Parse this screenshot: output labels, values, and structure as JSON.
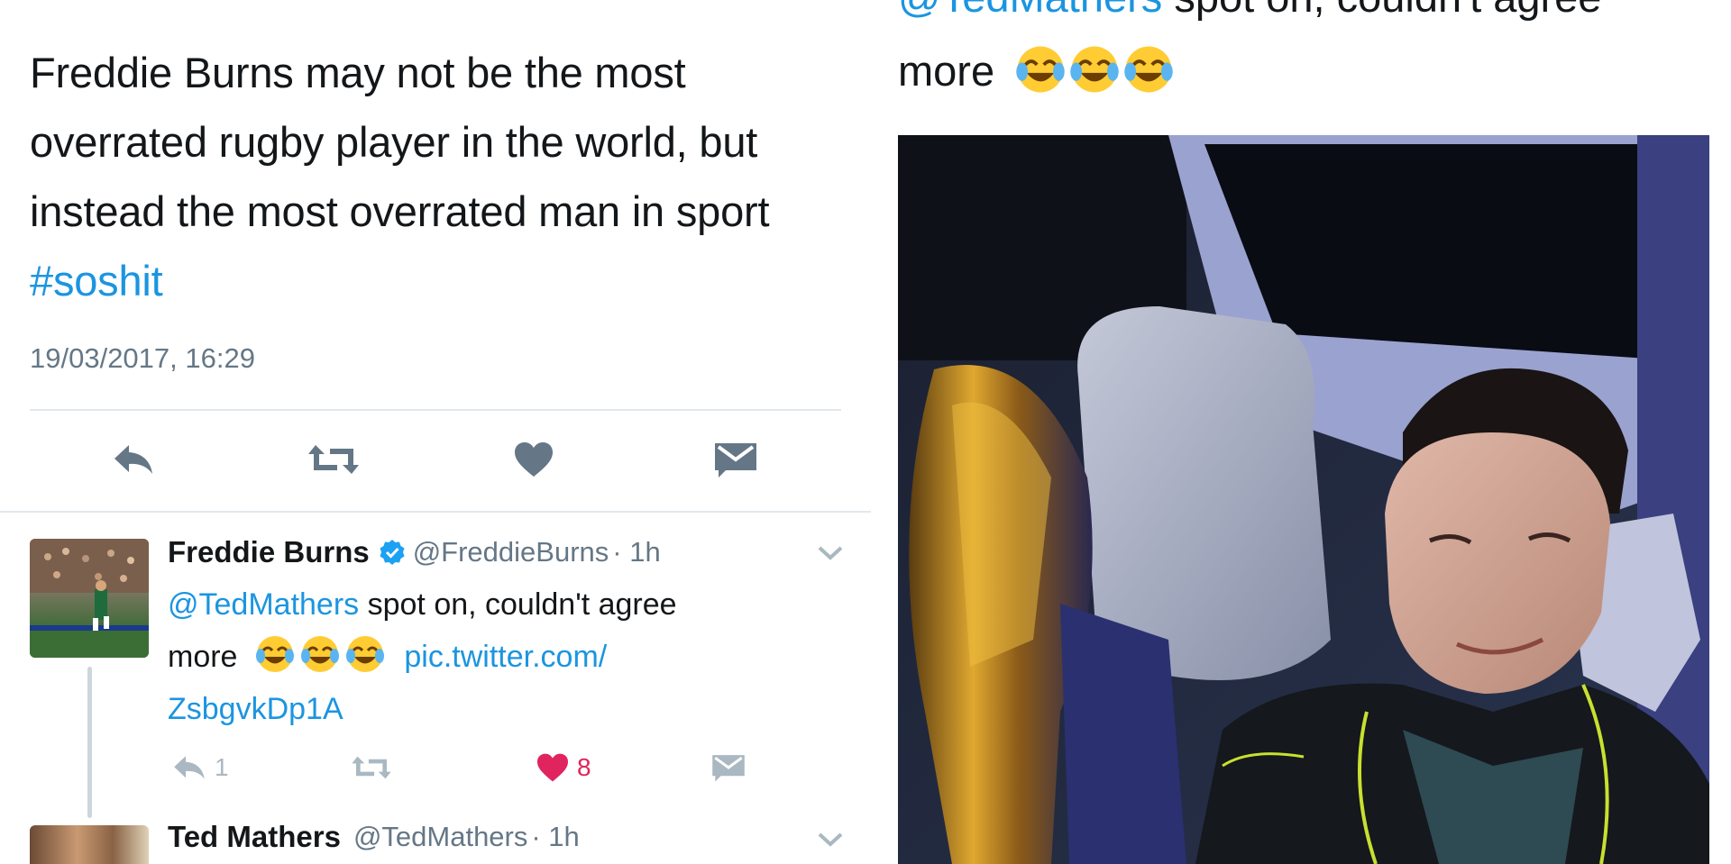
{
  "main_tweet": {
    "lines": [
      "Freddie Burns may not be the most",
      "overrated rugby player in the world, but",
      "instead the most overrated man in sport"
    ],
    "hashtag": "#soshit",
    "timestamp": "19/03/2017, 16:29"
  },
  "icons": {
    "reply": "reply-icon",
    "retweet": "retweet-icon",
    "like": "heart-icon",
    "dm": "envelope-icon",
    "verified": "verified-badge-icon",
    "chevron": "chevron-down-icon",
    "emoji": "tears-of-joy-emoji"
  },
  "reply_tweet": {
    "name": "Freddie Burns",
    "handle": "@FreddieBurns",
    "time": "· 1h",
    "mention": "@TedMathers",
    "text_after_mention": " spot on, couldn't agree",
    "more": "more",
    "link_part1": "pic.twitter.com/",
    "link_part2": "ZsbgvkDp1A",
    "reply_count": "1",
    "like_count": "8"
  },
  "next_tweet": {
    "name": "Ted Mathers",
    "handle": "@TedMathers",
    "time": "· 1h"
  },
  "right_panel": {
    "mention_cut": "@TedMathers",
    "text_cut": " spot on, couldn't agree",
    "more": "more"
  },
  "colors": {
    "link_blue": "#1b95e0",
    "like_red": "#e0245e",
    "muted_gray": "#657786",
    "icon_gray": "#aab8c2"
  }
}
